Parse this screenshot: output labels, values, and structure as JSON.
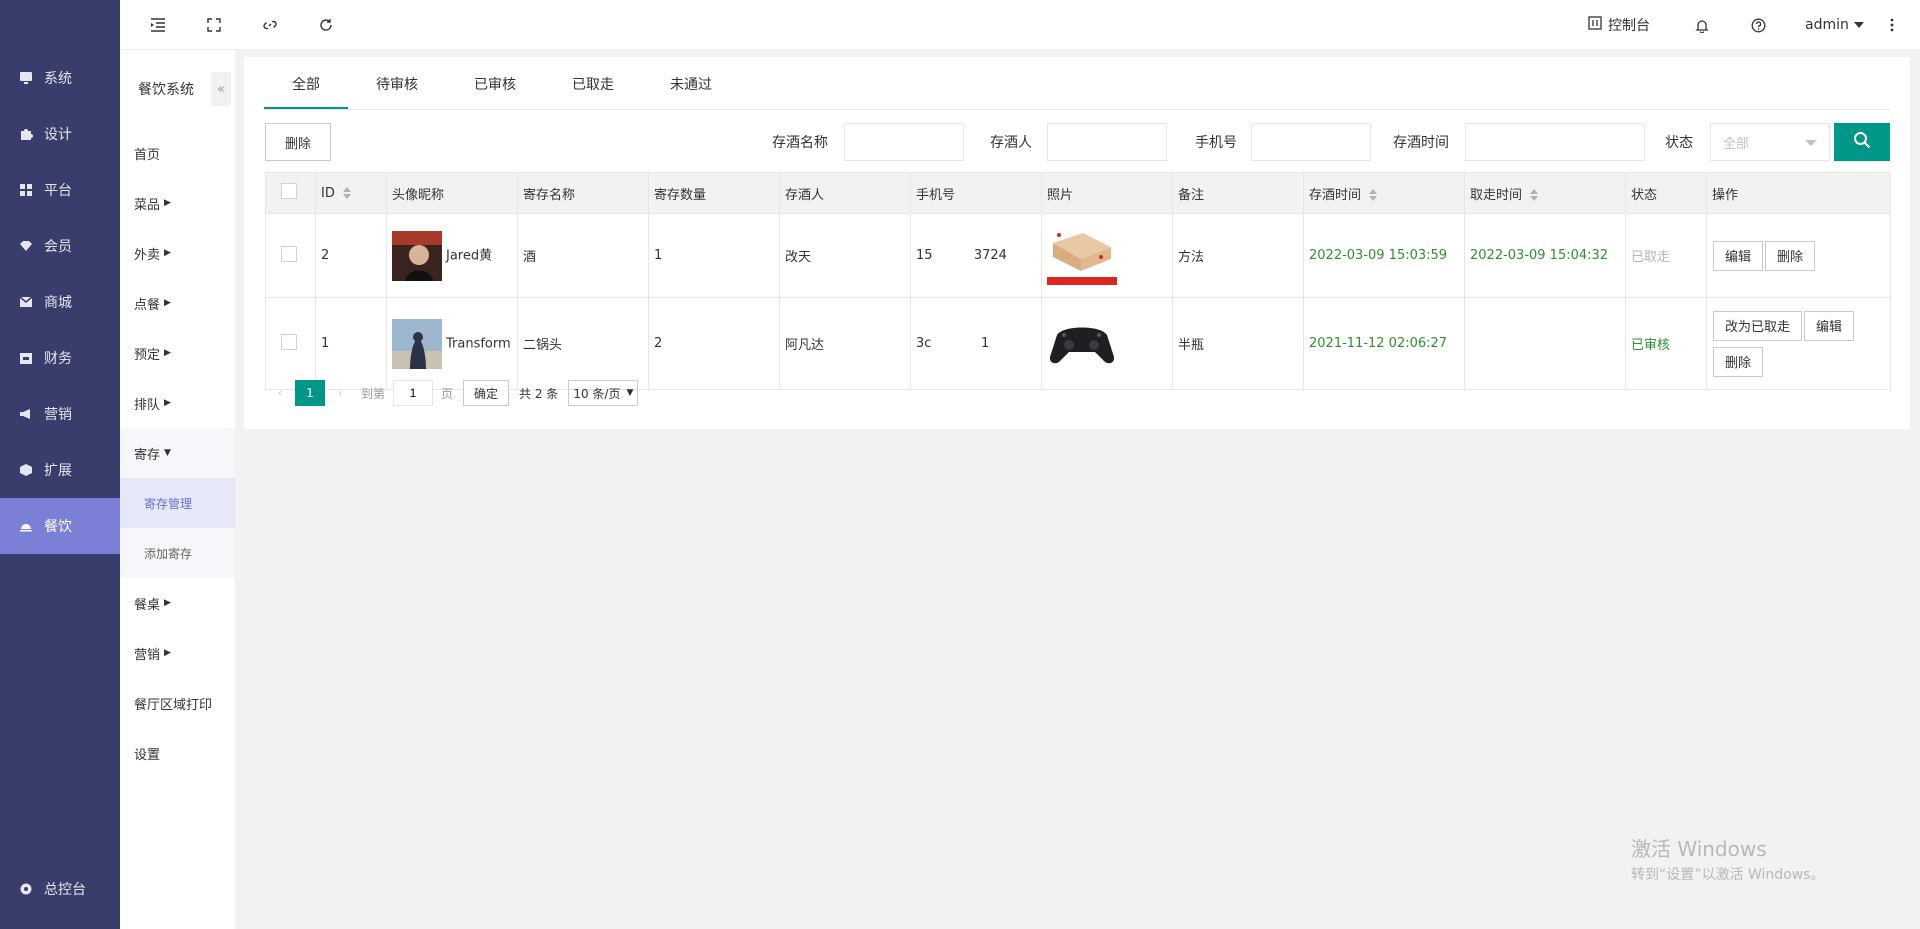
{
  "leftnav": {
    "items": [
      {
        "label": "系统",
        "icon": "monitor-icon"
      },
      {
        "label": "设计",
        "icon": "puzzle-icon"
      },
      {
        "label": "平台",
        "icon": "grid-icon"
      },
      {
        "label": "会员",
        "icon": "diamond-icon"
      },
      {
        "label": "商城",
        "icon": "mail-icon"
      },
      {
        "label": "财务",
        "icon": "wallet-icon"
      },
      {
        "label": "营销",
        "icon": "megaphone-icon"
      },
      {
        "label": "扩展",
        "icon": "cube-icon"
      },
      {
        "label": "餐饮",
        "icon": "cloche-icon"
      }
    ],
    "bottom_label": "总控台"
  },
  "subnav": {
    "title": "餐饮系统",
    "collapse_glyph": "«",
    "items": [
      "首页",
      "菜品",
      "外卖",
      "点餐",
      "预定",
      "排队",
      "寄存"
    ],
    "children": [
      "寄存管理",
      "添加寄存"
    ],
    "items_after": [
      "餐桌",
      "营销",
      "餐厅区域打印",
      "设置"
    ]
  },
  "topbar": {
    "console_label": "控制台",
    "user_label": "admin"
  },
  "tabs": [
    "全部",
    "待审核",
    "已审核",
    "已取走",
    "未通过"
  ],
  "toolbar": {
    "delete_label": "删除"
  },
  "filters": {
    "name_label": "存酒名称",
    "person_label": "存酒人",
    "phone_label": "手机号",
    "time_label": "存酒时间",
    "status_label": "状态",
    "status_value": "全部"
  },
  "table": {
    "headers": [
      "ID",
      "头像昵称",
      "寄存名称",
      "寄存数量",
      "存酒人",
      "手机号",
      "照片",
      "备注",
      "存酒时间",
      "取走时间",
      "状态",
      "操作"
    ],
    "rows": [
      {
        "id": "2",
        "nickname": "Jared黄",
        "name": "酒",
        "qty": "1",
        "person": "改天",
        "phone": "15          3724",
        "note": "方法",
        "store_time": "2022-03-09 15:03:59",
        "take_time": "2022-03-09 15:04:32",
        "status": "已取走",
        "ops": [
          "编辑",
          "删除"
        ]
      },
      {
        "id": "1",
        "nickname": "Transform",
        "name": "二锅头",
        "qty": "2",
        "person": "阿凡达",
        "phone": "3c            1",
        "note": "半瓶",
        "store_time": "2021-11-12 02:06:27",
        "take_time": "",
        "status": "已审核",
        "ops": [
          "改为已取走",
          "编辑",
          "删除"
        ]
      }
    ]
  },
  "pager": {
    "current": "1",
    "goto_label": "到第",
    "goto_value": "1",
    "page_label": "页",
    "confirm_label": "确定",
    "total_label": "共 2 条",
    "per_page": "10 条/页"
  },
  "watermark": {
    "line1": "激活 Windows",
    "line2": "转到“设置”以激活 Windows。"
  },
  "colors": {
    "accent": "#009688",
    "nav_bg": "#393d6b",
    "nav_active": "#7b7fd6"
  }
}
